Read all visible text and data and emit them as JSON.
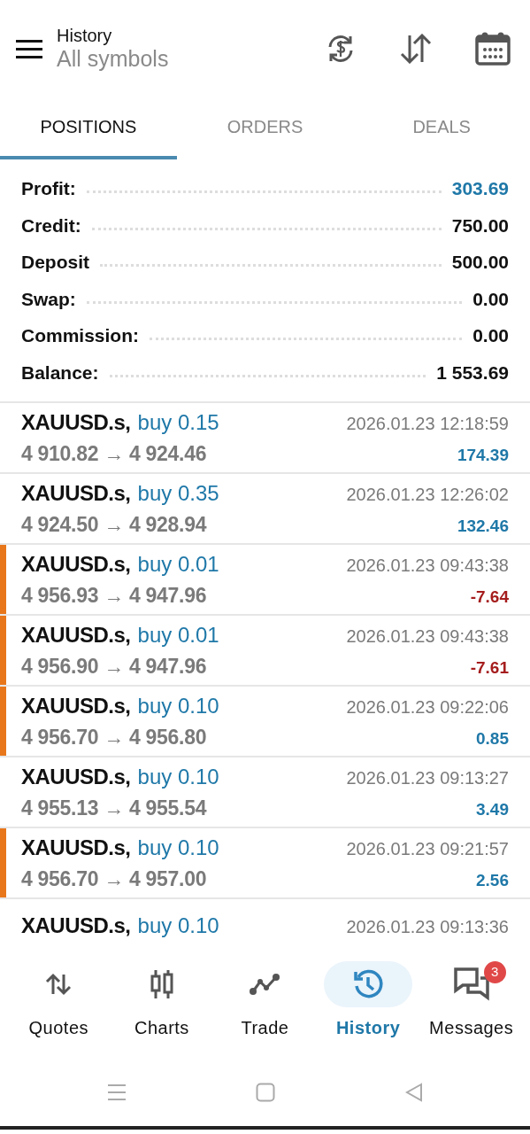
{
  "header": {
    "title": "History",
    "subtitle": "All symbols"
  },
  "tabs": [
    {
      "label": "POSITIONS",
      "selected": true
    },
    {
      "label": "ORDERS",
      "selected": false
    },
    {
      "label": "DEALS",
      "selected": false
    }
  ],
  "summary": [
    {
      "label": "Profit:",
      "value": "303.69",
      "highlight": true
    },
    {
      "label": "Credit:",
      "value": "750.00",
      "highlight": false
    },
    {
      "label": "Deposit",
      "value": "500.00",
      "highlight": false
    },
    {
      "label": "Swap:",
      "value": "0.00",
      "highlight": false
    },
    {
      "label": "Commission:",
      "value": "0.00",
      "highlight": false
    },
    {
      "label": "Balance:",
      "value": "1 553.69",
      "highlight": false
    }
  ],
  "positions": [
    {
      "symbol": "XAUUSD.s,",
      "side": "buy 0.15",
      "prices": "4 910.82 → 4 924.46",
      "time": "2026.01.23 12:18:59",
      "profit": "174.39",
      "loss": false,
      "marked": false
    },
    {
      "symbol": "XAUUSD.s,",
      "side": "buy 0.35",
      "prices": "4 924.50 → 4 928.94",
      "time": "2026.01.23 12:26:02",
      "profit": "132.46",
      "loss": false,
      "marked": false
    },
    {
      "symbol": "XAUUSD.s,",
      "side": "buy 0.01",
      "prices": "4 956.93 → 4 947.96",
      "time": "2026.01.23 09:43:38",
      "profit": "-7.64",
      "loss": true,
      "marked": true
    },
    {
      "symbol": "XAUUSD.s,",
      "side": "buy 0.01",
      "prices": "4 956.90 → 4 947.96",
      "time": "2026.01.23 09:43:38",
      "profit": "-7.61",
      "loss": true,
      "marked": true
    },
    {
      "symbol": "XAUUSD.s,",
      "side": "buy 0.10",
      "prices": "4 956.70 → 4 956.80",
      "time": "2026.01.23 09:22:06",
      "profit": "0.85",
      "loss": false,
      "marked": true
    },
    {
      "symbol": "XAUUSD.s,",
      "side": "buy 0.10",
      "prices": "4 955.13 → 4 955.54",
      "time": "2026.01.23 09:13:27",
      "profit": "3.49",
      "loss": false,
      "marked": false
    },
    {
      "symbol": "XAUUSD.s,",
      "side": "buy 0.10",
      "prices": "4 956.70 → 4 957.00",
      "time": "2026.01.23 09:21:57",
      "profit": "2.56",
      "loss": false,
      "marked": true
    },
    {
      "symbol": "XAUUSD.s,",
      "side": "buy 0.10",
      "time": "2026.01.23 09:13:36",
      "marked": false
    }
  ],
  "nav": [
    {
      "kind": "quotes",
      "label": "Quotes",
      "selected": false
    },
    {
      "kind": "charts",
      "label": "Charts",
      "selected": false
    },
    {
      "kind": "trade",
      "label": "Trade",
      "selected": false
    },
    {
      "kind": "history",
      "label": "History",
      "selected": true
    },
    {
      "kind": "messages",
      "label": "Messages",
      "selected": false,
      "badge": "3"
    }
  ]
}
